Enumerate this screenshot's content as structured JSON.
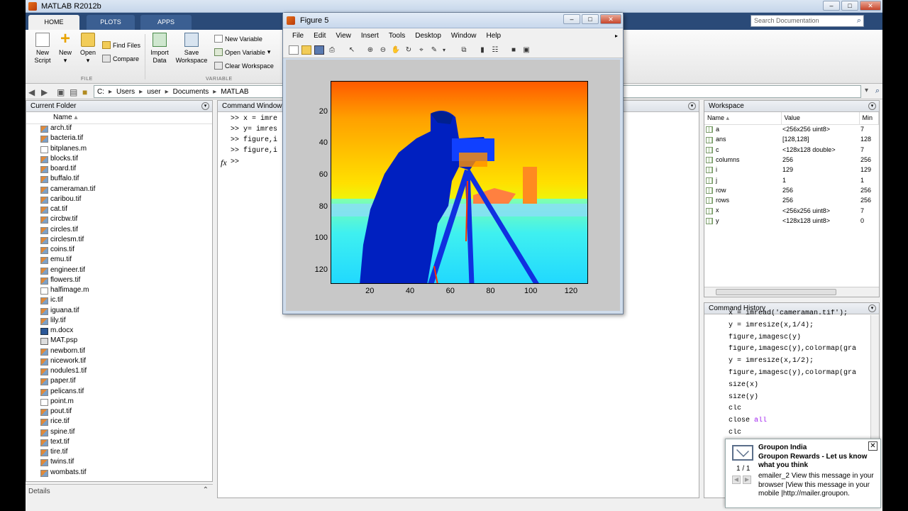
{
  "window": {
    "title": "MATLAB R2012b",
    "controls": [
      "–",
      "□",
      "✕"
    ]
  },
  "tabs": [
    "HOME",
    "PLOTS",
    "APPS"
  ],
  "search": {
    "placeholder": "Search Documentation"
  },
  "ribbon": {
    "new_script": "New Script",
    "new": "New",
    "open": "Open",
    "find_files": "Find Files",
    "compare": "Compare",
    "import_data": "Import Data",
    "save_workspace": "Save Workspace",
    "new_variable": "New Variable",
    "open_variable": "Open Variable",
    "clear_workspace": "Clear Workspace",
    "group_file": "FILE",
    "group_variable": "VARIABLE"
  },
  "address": {
    "path": [
      "C:",
      "Users",
      "user",
      "Documents",
      "MATLAB"
    ]
  },
  "current_folder": {
    "title": "Current Folder",
    "column": "Name",
    "files": [
      {
        "name": "arch.tif",
        "type": "tif"
      },
      {
        "name": "bacteria.tif",
        "type": "tif"
      },
      {
        "name": "bitplanes.m",
        "type": "m"
      },
      {
        "name": "blocks.tif",
        "type": "tif"
      },
      {
        "name": "board.tif",
        "type": "tif"
      },
      {
        "name": "buffalo.tif",
        "type": "tif"
      },
      {
        "name": "cameraman.tif",
        "type": "tif"
      },
      {
        "name": "caribou.tif",
        "type": "tif"
      },
      {
        "name": "cat.tif",
        "type": "tif"
      },
      {
        "name": "circbw.tif",
        "type": "tif"
      },
      {
        "name": "circles.tif",
        "type": "tif"
      },
      {
        "name": "circlesm.tif",
        "type": "tif"
      },
      {
        "name": "coins.tif",
        "type": "tif"
      },
      {
        "name": "emu.tif",
        "type": "tif"
      },
      {
        "name": "engineer.tif",
        "type": "tif"
      },
      {
        "name": "flowers.tif",
        "type": "tif"
      },
      {
        "name": "halfimage.m",
        "type": "m"
      },
      {
        "name": "ic.tif",
        "type": "tif"
      },
      {
        "name": "iguana.tif",
        "type": "tif"
      },
      {
        "name": "lily.tif",
        "type": "tif"
      },
      {
        "name": "m.docx",
        "type": "doc"
      },
      {
        "name": "MAT.psp",
        "type": "psp"
      },
      {
        "name": "newborn.tif",
        "type": "tif"
      },
      {
        "name": "nicework.tif",
        "type": "tif"
      },
      {
        "name": "nodules1.tif",
        "type": "tif"
      },
      {
        "name": "paper.tif",
        "type": "tif"
      },
      {
        "name": "pelicans.tif",
        "type": "tif"
      },
      {
        "name": "point.m",
        "type": "m"
      },
      {
        "name": "pout.tif",
        "type": "tif"
      },
      {
        "name": "rice.tif",
        "type": "tif"
      },
      {
        "name": "spine.tif",
        "type": "tif"
      },
      {
        "name": "text.tif",
        "type": "tif"
      },
      {
        "name": "tire.tif",
        "type": "tif"
      },
      {
        "name": "twins.tif",
        "type": "tif"
      },
      {
        "name": "wombats.tif",
        "type": "tif"
      }
    ],
    "details": "Details"
  },
  "command_window": {
    "title": "Command Window",
    "lines": [
      ">> x = imre",
      ">> y= imres",
      ">> figure,i",
      ">> figure,i"
    ],
    "prompt": ">>",
    "fx": "fx"
  },
  "workspace": {
    "title": "Workspace",
    "columns": [
      "Name",
      "Value",
      "Min"
    ],
    "rows": [
      {
        "name": "a",
        "value": "<256x256 uint8>",
        "min": "7"
      },
      {
        "name": "ans",
        "value": "[128,128]",
        "min": "128"
      },
      {
        "name": "c",
        "value": "<128x128 double>",
        "min": "7"
      },
      {
        "name": "columns",
        "value": "256",
        "min": "256"
      },
      {
        "name": "i",
        "value": "129",
        "min": "129"
      },
      {
        "name": "j",
        "value": "1",
        "min": "1"
      },
      {
        "name": "row",
        "value": "256",
        "min": "256"
      },
      {
        "name": "rows",
        "value": "256",
        "min": "256"
      },
      {
        "name": "x",
        "value": "<256x256 uint8>",
        "min": "7"
      },
      {
        "name": "y",
        "value": "<128x128 uint8>",
        "min": "0"
      }
    ]
  },
  "command_history": {
    "title": "Command History",
    "lines": [
      "x = imread('cameraman.tif');",
      "y = imresize(x,1/4);",
      "figure,imagesc(y)",
      "figure,imagesc(y),colormap(gra",
      "y = imresize(x,1/2);",
      "figure,imagesc(y),colormap(gra",
      "size(x)",
      "size(y)",
      "clc",
      "close all",
      "clc"
    ]
  },
  "figure": {
    "title": "Figure 5",
    "menu": [
      "File",
      "Edit",
      "View",
      "Insert",
      "Tools",
      "Desktop",
      "Window",
      "Help"
    ],
    "xticks": [
      "20",
      "40",
      "60",
      "80",
      "100",
      "120"
    ],
    "yticks": [
      "20",
      "40",
      "60",
      "80",
      "100",
      "120"
    ],
    "xlim": [
      0.5,
      128.5
    ],
    "ylim": [
      0.5,
      128.5
    ]
  },
  "notification": {
    "sender": "Groupon India",
    "subject": "Groupon Rewards - Let us know what you think",
    "count": "1 / 1",
    "body": "emailer_2 View this message in your browser |View this message in your mobile |http://mailer.groupon.",
    "close": "✕"
  }
}
